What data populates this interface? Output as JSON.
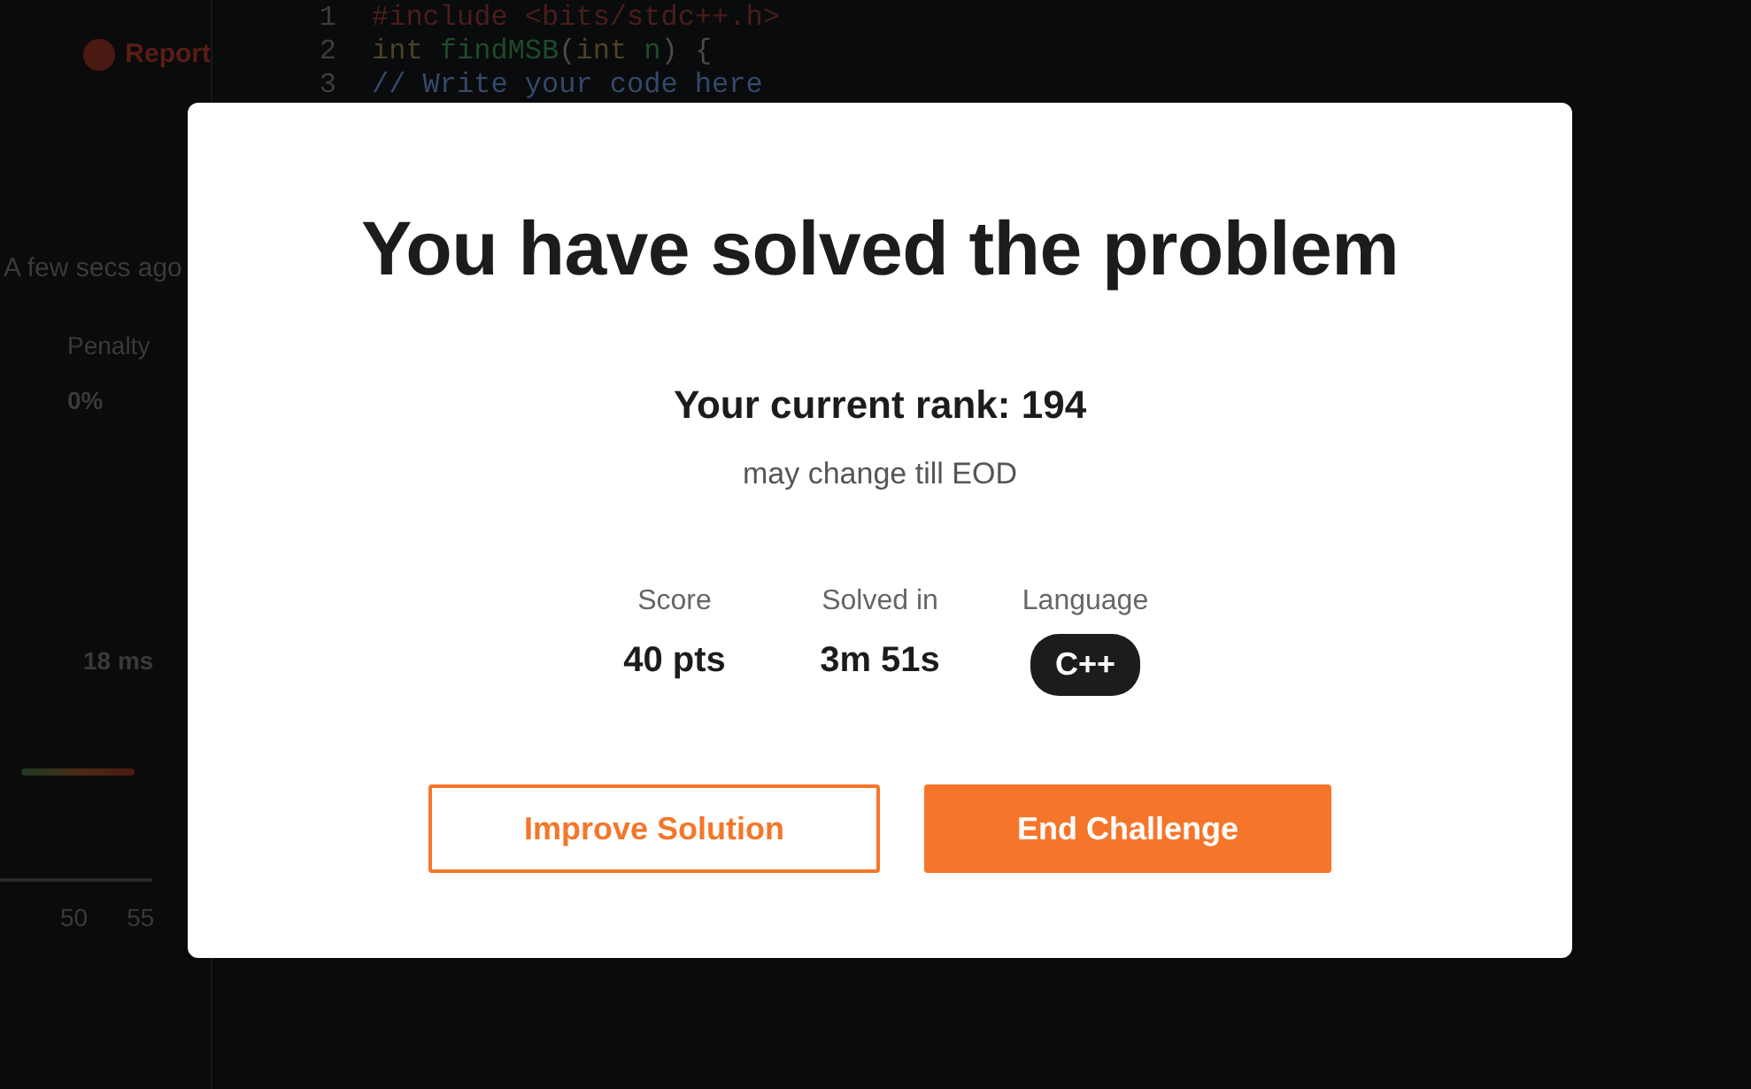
{
  "background": {
    "report_button": "Report",
    "code_lines": [
      {
        "number": "1",
        "tokens": [
          {
            "text": "#include <bits/stdc++.h>",
            "kind": "preprocessor"
          }
        ]
      },
      {
        "number": "2",
        "tokens": [
          {
            "text": "int ",
            "kind": "keyword"
          },
          {
            "text": "findMSB",
            "kind": "function"
          },
          {
            "text": "(",
            "kind": "plain"
          },
          {
            "text": "int ",
            "kind": "keyword"
          },
          {
            "text": "n",
            "kind": "function"
          },
          {
            "text": ") {",
            "kind": "plain"
          }
        ]
      },
      {
        "number": "3",
        "tokens": [
          {
            "text": "// Write your code here",
            "kind": "comment"
          }
        ]
      }
    ],
    "submission_time": "A few secs ago",
    "penalty_label": "Penalty",
    "penalty_value": "0%",
    "runtime": "18 ms",
    "axis_ticks": [
      "50",
      "55"
    ]
  },
  "modal": {
    "title": "You have solved the problem",
    "rank": "Your current rank: 194",
    "rank_note": "may change till EOD",
    "stats": [
      {
        "label": "Score",
        "value": "40 pts",
        "kind": "text"
      },
      {
        "label": "Solved in",
        "value": "3m 51s",
        "kind": "text"
      },
      {
        "label": "Language",
        "value": "C++",
        "kind": "badge"
      }
    ],
    "buttons": [
      {
        "label": "Improve Solution",
        "kind": "outline"
      },
      {
        "label": "End Challenge",
        "kind": "primary"
      }
    ]
  }
}
